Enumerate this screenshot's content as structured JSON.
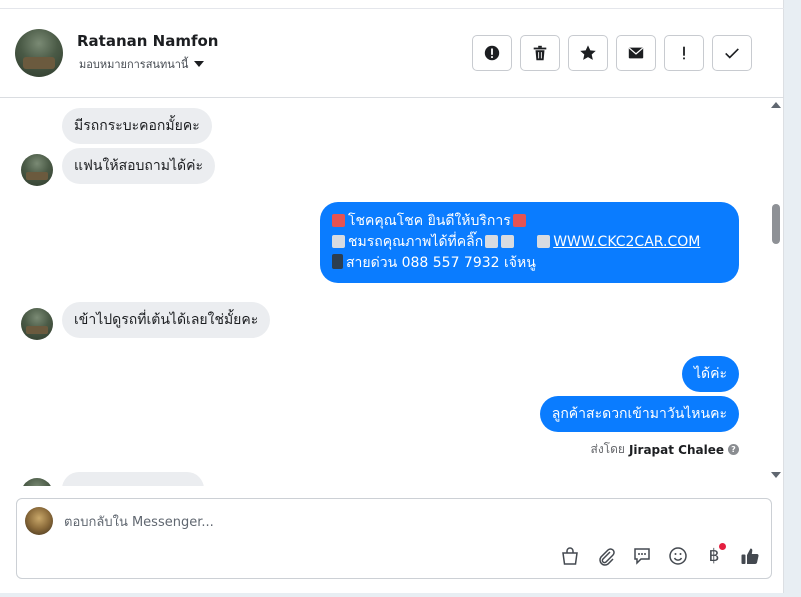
{
  "header": {
    "contact_name": "Ratanan Namfon",
    "assign_label": "มอบหมายการสนทนานี้",
    "actions": [
      {
        "name": "spam-icon",
        "glyph": "!"
      },
      {
        "name": "trash-icon"
      },
      {
        "name": "star-icon"
      },
      {
        "name": "mail-icon"
      },
      {
        "name": "exclamation-icon",
        "glyph": "!"
      },
      {
        "name": "check-icon"
      }
    ]
  },
  "messages": [
    {
      "side": "in",
      "text": "มีรถกระบะคอกมั้ยคะ",
      "avatar": false
    },
    {
      "side": "in",
      "text": "แฟนให้สอบถามได้ค่ะ",
      "avatar": true
    },
    {
      "side": "out",
      "type": "promo",
      "line1": "โชคคุณโชค ยินดีให้บริการ",
      "line2_text": "ชมรถคุณภาพได้ที่คลิ๊ก",
      "link": "WWW.CKC2CAR.COM",
      "line3": "สายด่วน 088 557 7932 เจ้หนู"
    },
    {
      "side": "in",
      "text": "เข้าไปดูรถที่เต้นได้เลยใช่มั้ยคะ",
      "avatar": true
    },
    {
      "side": "out",
      "text": "ได้ค่ะ"
    },
    {
      "side": "out",
      "text": "ลูกค้าสะดวกเข้ามาวันไหนคะ"
    }
  ],
  "sent_by": {
    "prefix": "ส่งโดย",
    "name": "Jirapat Chalee",
    "help": "?"
  },
  "composer": {
    "placeholder": "ตอบกลับใน Messenger...",
    "currency": "฿"
  },
  "colors": {
    "outgoing": "#0a7cff",
    "incoming": "#ebedf0",
    "like": "#444950"
  }
}
